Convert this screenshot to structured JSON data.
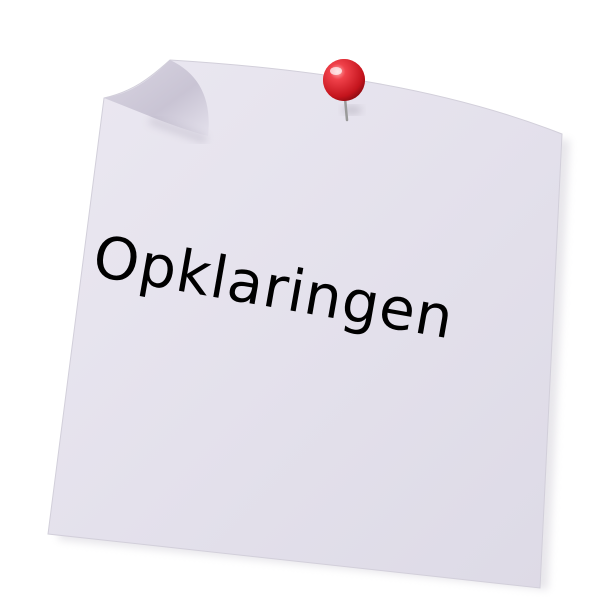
{
  "note": {
    "text": "Opklaringen",
    "paper_color": "#e7e4ee",
    "text_color": "#000000",
    "pin_color": "#e8232a"
  }
}
